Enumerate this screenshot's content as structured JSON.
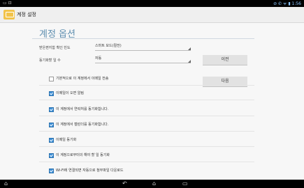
{
  "status_bar": {
    "left_icons": "▭ ⊡",
    "right_text": "⊘ ✆ ᯤ ▮ 1:56"
  },
  "action_bar": {
    "title": "계정 설정"
  },
  "section": {
    "title": "계정 옵션"
  },
  "settings": {
    "inbox_check": {
      "label": "받은편지함 확인 빈도",
      "value": "스마트 모드(절전)"
    },
    "sync_days": {
      "label": "동기화할 일 수",
      "value": "자동"
    }
  },
  "buttons": {
    "previous": "이전",
    "next": "다음"
  },
  "checkboxes": [
    {
      "label": "기본적으로 이 계정에서 이메일 전송",
      "checked": false
    },
    {
      "label": "이메일이 오면 알림",
      "checked": true
    },
    {
      "label": "이 계정에서 연락처를 동기화합니다.",
      "checked": true
    },
    {
      "label": "이 계정에서 캘린더를 동기화합니다.",
      "checked": true
    },
    {
      "label": "이메일 동기화",
      "checked": true
    },
    {
      "label": "이 계정으로부터의 해야 할 일 동기화",
      "checked": true
    },
    {
      "label": "Wi-Fi에 연결되면 자동으로 첨부파일 다운로드",
      "checked": true
    }
  ],
  "nav_bar": {
    "keyboard_icon": "⌂",
    "back_icon": "↶",
    "home_icon": "⌂",
    "recents_icon": "▭"
  }
}
